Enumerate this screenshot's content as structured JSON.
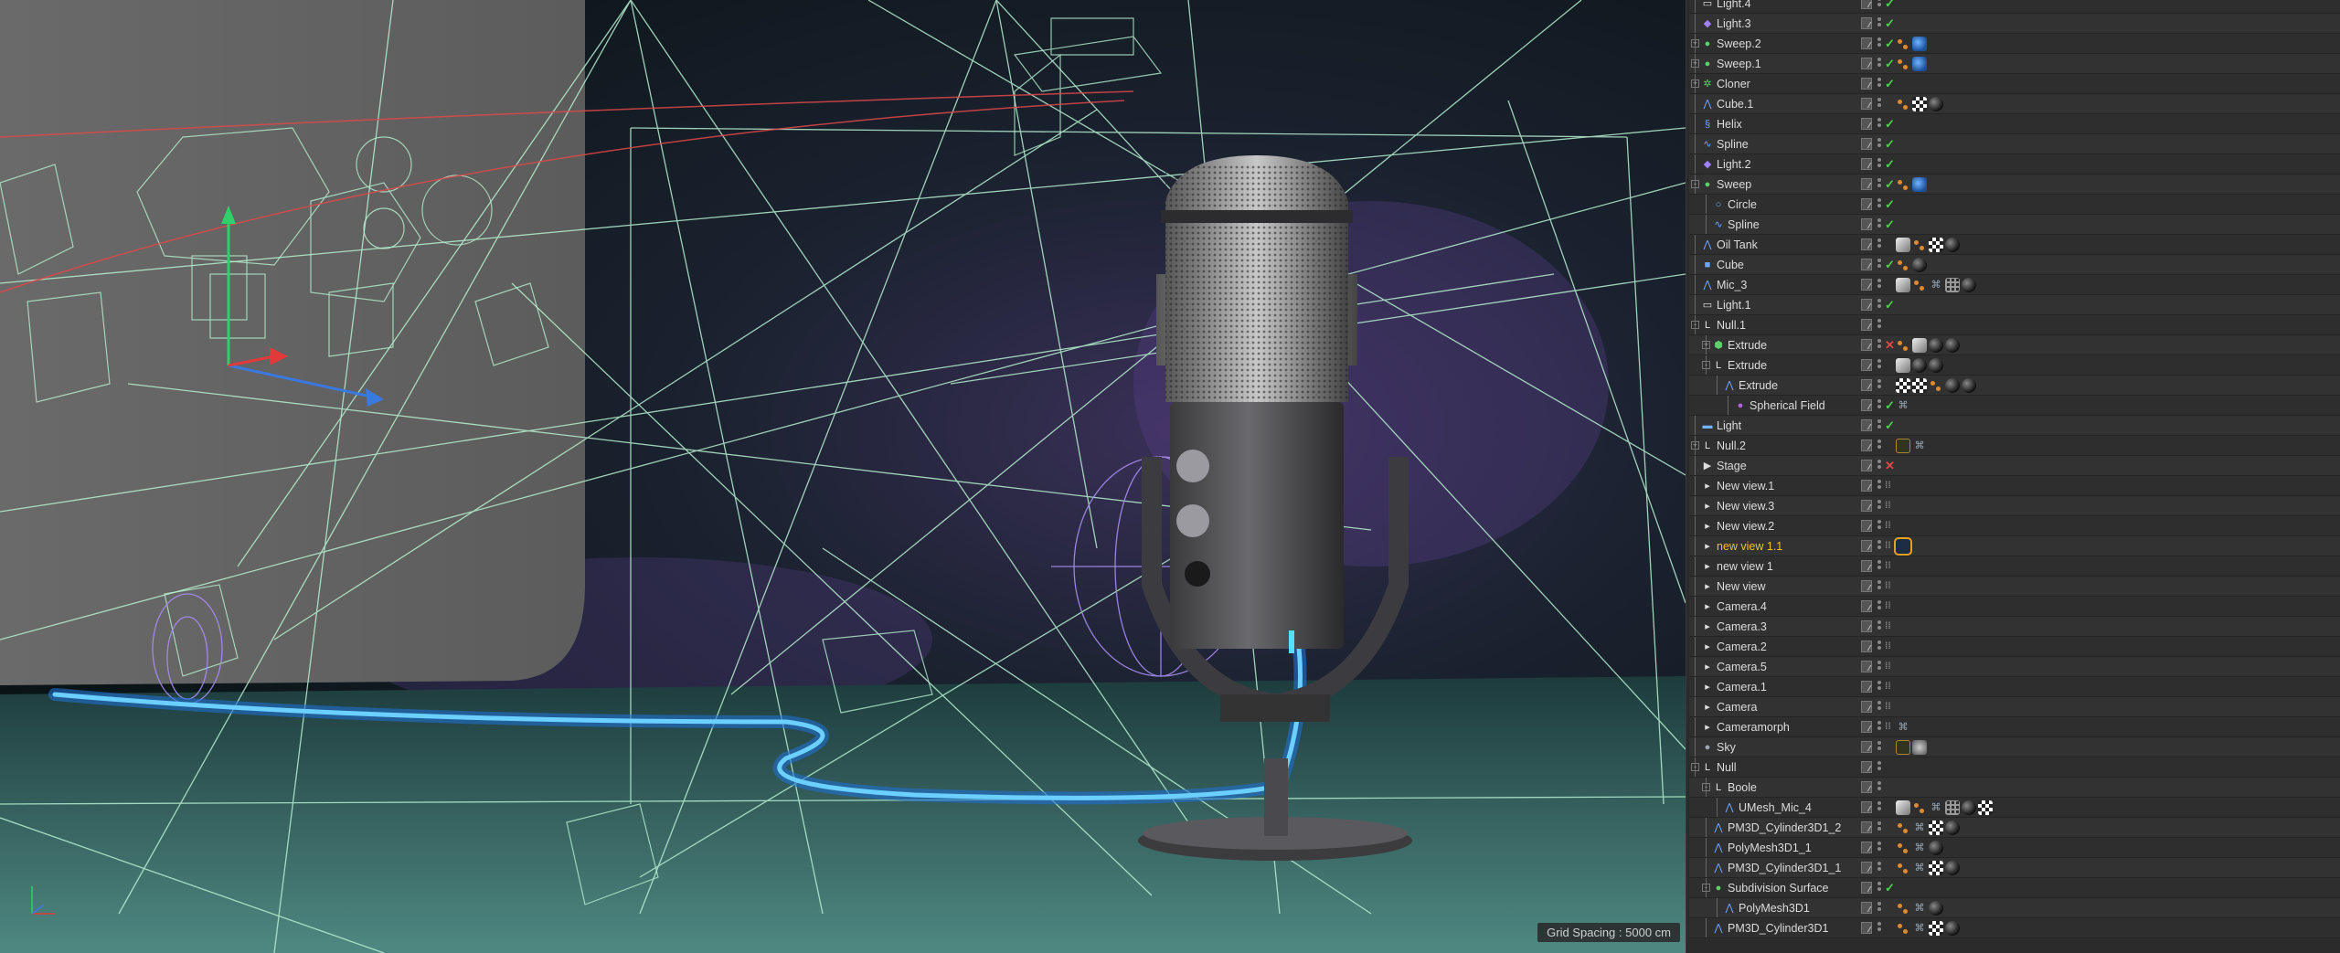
{
  "viewport": {
    "grid_spacing_label": "Grid Spacing : 5000 cm",
    "colors": {
      "background": "#0d1a1d",
      "wireframe": "#b7f0d0",
      "cable": "#3ab0ff"
    }
  },
  "object_manager": {
    "rows": [
      {
        "name": "Light.4",
        "depth": 0,
        "icon": "light-icon",
        "icon_char": "▭",
        "icon_color": "#e8e8e8",
        "state": "check",
        "tags": []
      },
      {
        "name": "Light.3",
        "depth": 0,
        "icon": "light-icon",
        "icon_char": "◆",
        "icon_color": "#a080ff",
        "state": "check",
        "tags": []
      },
      {
        "name": "Sweep.2",
        "depth": 0,
        "expander": "+",
        "icon": "sweep-icon",
        "icon_char": "●",
        "icon_color": "#5ad16a",
        "state": "check",
        "tags": [
          "orange",
          "blue"
        ]
      },
      {
        "name": "Sweep.1",
        "depth": 0,
        "expander": "+",
        "icon": "sweep-icon",
        "icon_char": "●",
        "icon_color": "#5ad16a",
        "state": "check",
        "tags": [
          "orange",
          "blue"
        ]
      },
      {
        "name": "Cloner",
        "depth": 0,
        "expander": "+",
        "icon": "cloner-icon",
        "icon_char": "✲",
        "icon_color": "#5ad16a",
        "state": "check",
        "tags": []
      },
      {
        "name": "Cube.1",
        "depth": 0,
        "icon": "polygon-object-icon",
        "icon_char": "⋀",
        "icon_color": "#6fa8ff",
        "state": "",
        "tags": [
          "orange",
          "check",
          "sphere"
        ]
      },
      {
        "name": "Helix",
        "depth": 0,
        "icon": "helix-icon",
        "icon_char": "§",
        "icon_color": "#6fa8ff",
        "state": "check",
        "tags": []
      },
      {
        "name": "Spline",
        "depth": 0,
        "icon": "spline-icon",
        "icon_char": "∿",
        "icon_color": "#6fa8ff",
        "state": "check",
        "tags": []
      },
      {
        "name": "Light.2",
        "depth": 0,
        "icon": "light-icon",
        "icon_char": "◆",
        "icon_color": "#a080ff",
        "state": "check",
        "tags": []
      },
      {
        "name": "Sweep",
        "depth": 0,
        "expander": "-",
        "icon": "sweep-icon",
        "icon_char": "●",
        "icon_color": "#5ad16a",
        "state": "check",
        "tags": [
          "orange",
          "blue"
        ]
      },
      {
        "name": "Circle",
        "depth": 1,
        "icon": "circle-spline-icon",
        "icon_char": "○",
        "icon_color": "#6fa8ff",
        "state": "check",
        "tags": []
      },
      {
        "name": "Spline",
        "depth": 1,
        "icon": "spline-icon",
        "icon_char": "∿",
        "icon_color": "#6fa8ff",
        "state": "check",
        "tags": []
      },
      {
        "name": "Oil Tank",
        "depth": 0,
        "icon": "polygon-object-icon",
        "icon_char": "⋀",
        "icon_color": "#6fa8ff",
        "state": "",
        "tags": [
          "grey",
          "orange",
          "check",
          "sphere"
        ]
      },
      {
        "name": "Cube",
        "depth": 0,
        "icon": "cube-icon",
        "icon_char": "■",
        "icon_color": "#6fa8ff",
        "state": "check",
        "tags": [
          "orange",
          "sphere"
        ]
      },
      {
        "name": "Mic_3",
        "depth": 0,
        "icon": "polygon-object-icon",
        "icon_char": "⋀",
        "icon_color": "#6fa8ff",
        "state": "",
        "tags": [
          "grey",
          "orange",
          "wire",
          "grid",
          "sphere"
        ]
      },
      {
        "name": "Light.1",
        "depth": 0,
        "icon": "light-icon",
        "icon_char": "▭",
        "icon_color": "#e8e8e8",
        "state": "check",
        "tags": []
      },
      {
        "name": "Null.1",
        "depth": 0,
        "expander": "-",
        "icon": "null-icon",
        "icon_char": "L",
        "icon_color": "#e8e8e8",
        "state": "",
        "tags": []
      },
      {
        "name": "Extrude",
        "depth": 1,
        "expander": "+",
        "icon": "extrude-icon",
        "icon_char": "⬢",
        "icon_color": "#5ad16a",
        "state": "cross",
        "tags": [
          "orange",
          "grey",
          "sphere",
          "sphere"
        ]
      },
      {
        "name": "Extrude",
        "depth": 1,
        "expander": "-",
        "icon": "null-icon",
        "icon_char": "L",
        "icon_color": "#e8e8e8",
        "state": "",
        "tags": [
          "grey",
          "sphere",
          "sphere"
        ]
      },
      {
        "name": "Extrude",
        "depth": 2,
        "icon": "polygon-object-icon",
        "icon_char": "⋀",
        "icon_color": "#6fa8ff",
        "state": "",
        "tags": [
          "check",
          "check",
          "orange",
          "sphere",
          "sphere"
        ]
      },
      {
        "name": "Spherical Field",
        "depth": 3,
        "icon": "field-icon",
        "icon_char": "●",
        "icon_color": "#b060e0",
        "state": "check",
        "tags": [
          "wire"
        ]
      },
      {
        "name": "Light",
        "depth": 0,
        "icon": "area-light-icon",
        "icon_char": "▬",
        "icon_color": "#6fb5ff",
        "state": "check",
        "tags": []
      },
      {
        "name": "Null.2",
        "depth": 0,
        "expander": "+",
        "icon": "null-icon",
        "icon_char": "L",
        "icon_color": "#e8e8e8",
        "state": "",
        "tags": [
          "film",
          "wire"
        ]
      },
      {
        "name": "Stage",
        "depth": 0,
        "icon": "stage-icon",
        "icon_char": "▶",
        "icon_color": "#dddddd",
        "state": "cross",
        "tags": []
      },
      {
        "name": "New view.1",
        "depth": 0,
        "icon": "camera-icon",
        "icon_char": "▸",
        "icon_color": "#dddddd",
        "state": "dots",
        "tags": []
      },
      {
        "name": "New view.3",
        "depth": 0,
        "icon": "camera-icon",
        "icon_char": "▸",
        "icon_color": "#dddddd",
        "state": "dots",
        "tags": []
      },
      {
        "name": "New view.2",
        "depth": 0,
        "icon": "camera-icon",
        "icon_char": "▸",
        "icon_color": "#dddddd",
        "state": "dots",
        "tags": []
      },
      {
        "name": "new view 1.1",
        "depth": 0,
        "icon": "camera-icon",
        "icon_char": "▸",
        "icon_color": "#dddddd",
        "state": "dots",
        "tags": [
          "sel"
        ],
        "active": true
      },
      {
        "name": "new view 1",
        "depth": 0,
        "icon": "camera-icon",
        "icon_char": "▸",
        "icon_color": "#dddddd",
        "state": "dots",
        "tags": []
      },
      {
        "name": "New view",
        "depth": 0,
        "icon": "camera-icon",
        "icon_char": "▸",
        "icon_color": "#dddddd",
        "state": "dots",
        "tags": []
      },
      {
        "name": "Camera.4",
        "depth": 0,
        "icon": "camera-icon",
        "icon_char": "▸",
        "icon_color": "#dddddd",
        "state": "dots",
        "tags": []
      },
      {
        "name": "Camera.3",
        "depth": 0,
        "icon": "camera-icon",
        "icon_char": "▸",
        "icon_color": "#dddddd",
        "state": "dots",
        "tags": []
      },
      {
        "name": "Camera.2",
        "depth": 0,
        "icon": "camera-icon",
        "icon_char": "▸",
        "icon_color": "#dddddd",
        "state": "dots",
        "tags": []
      },
      {
        "name": "Camera.5",
        "depth": 0,
        "icon": "camera-icon",
        "icon_char": "▸",
        "icon_color": "#dddddd",
        "state": "dots",
        "tags": []
      },
      {
        "name": "Camera.1",
        "depth": 0,
        "icon": "camera-icon",
        "icon_char": "▸",
        "icon_color": "#dddddd",
        "state": "dots",
        "tags": []
      },
      {
        "name": "Camera",
        "depth": 0,
        "icon": "camera-icon",
        "icon_char": "▸",
        "icon_color": "#dddddd",
        "state": "dots",
        "tags": []
      },
      {
        "name": "Cameramorph",
        "depth": 0,
        "icon": "camera-icon",
        "icon_char": "▸",
        "icon_color": "#dddddd",
        "state": "dots",
        "tags": [
          "wire"
        ]
      },
      {
        "name": "Sky",
        "depth": 0,
        "icon": "sky-icon",
        "icon_char": "●",
        "icon_color": "#9aa7b8",
        "state": "",
        "tags": [
          "film",
          "sky"
        ]
      },
      {
        "name": "Null",
        "depth": 0,
        "expander": "-",
        "icon": "null-icon",
        "icon_char": "L",
        "icon_color": "#e8e8e8",
        "state": "",
        "tags": []
      },
      {
        "name": "Boole",
        "depth": 1,
        "expander": "-",
        "icon": "null-icon",
        "icon_char": "L",
        "icon_color": "#e8e8e8",
        "state": "",
        "tags": []
      },
      {
        "name": "UMesh_Mic_4",
        "depth": 2,
        "icon": "polygon-object-icon",
        "icon_char": "⋀",
        "icon_color": "#6fa8ff",
        "state": "",
        "tags": [
          "grey",
          "orange",
          "wire",
          "grid",
          "sphere",
          "check"
        ]
      },
      {
        "name": "PM3D_Cylinder3D1_2",
        "depth": 1,
        "icon": "polygon-object-icon",
        "icon_char": "⋀",
        "icon_color": "#6fa8ff",
        "state": "",
        "tags": [
          "orange",
          "wire",
          "check",
          "sphere"
        ]
      },
      {
        "name": "PolyMesh3D1_1",
        "depth": 1,
        "icon": "polygon-object-icon",
        "icon_char": "⋀",
        "icon_color": "#6fa8ff",
        "state": "",
        "tags": [
          "orange",
          "wire",
          "sphere"
        ]
      },
      {
        "name": "PM3D_Cylinder3D1_1",
        "depth": 1,
        "icon": "polygon-object-icon",
        "icon_char": "⋀",
        "icon_color": "#6fa8ff",
        "state": "",
        "tags": [
          "orange",
          "wire",
          "check",
          "sphere"
        ]
      },
      {
        "name": "Subdivision Surface",
        "depth": 1,
        "expander": "-",
        "icon": "subdivision-icon",
        "icon_char": "●",
        "icon_color": "#5ad16a",
        "state": "check",
        "tags": []
      },
      {
        "name": "PolyMesh3D1",
        "depth": 2,
        "icon": "polygon-object-icon",
        "icon_char": "⋀",
        "icon_color": "#6fa8ff",
        "state": "",
        "tags": [
          "orange",
          "wire",
          "sphere"
        ]
      },
      {
        "name": "PM3D_Cylinder3D1",
        "depth": 1,
        "icon": "polygon-object-icon",
        "icon_char": "⋀",
        "icon_color": "#6fa8ff",
        "state": "",
        "tags": [
          "orange",
          "wire",
          "check",
          "sphere"
        ]
      }
    ]
  }
}
